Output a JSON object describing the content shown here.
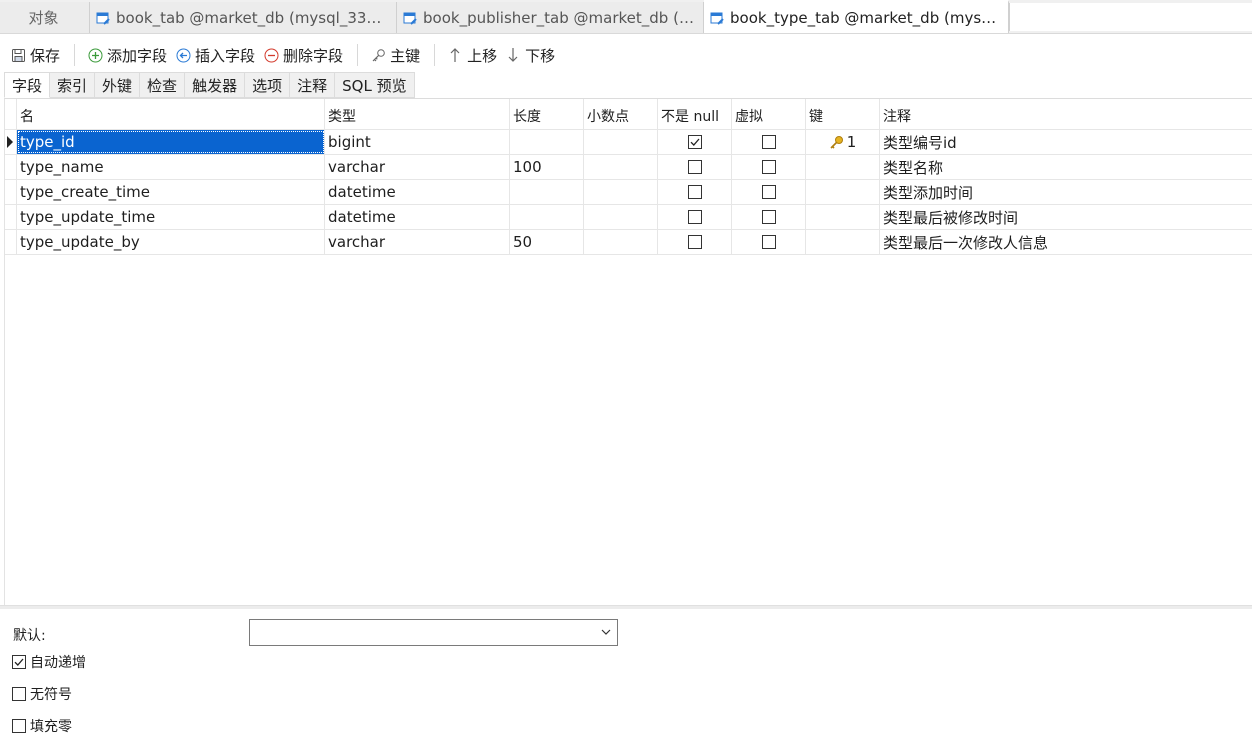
{
  "doc_tabs": {
    "objects": "对象",
    "tab1": "book_tab @market_db (mysql_3306)...",
    "tab2": "book_publisher_tab @market_db (m...",
    "tab3": "book_type_tab @market_db (mysql_..."
  },
  "toolbar": {
    "save": "保存",
    "add_field": "添加字段",
    "insert_field": "插入字段",
    "delete_field": "删除字段",
    "primary_key": "主键",
    "move_up": "上移",
    "move_down": "下移"
  },
  "sub_tabs": [
    "字段",
    "索引",
    "外键",
    "检查",
    "触发器",
    "选项",
    "注释",
    "SQL 预览"
  ],
  "grid": {
    "headers": {
      "name": "名",
      "type": "类型",
      "length": "长度",
      "decimal": "小数点",
      "not_null": "不是 null",
      "virtual": "虚拟",
      "key": "键",
      "comment": "注释"
    },
    "rows": [
      {
        "name": "type_id",
        "type": "bigint",
        "length": "",
        "decimal": "",
        "not_null": true,
        "virtual": false,
        "key": "1",
        "comment": "类型编号id"
      },
      {
        "name": "type_name",
        "type": "varchar",
        "length": "100",
        "decimal": "",
        "not_null": false,
        "virtual": false,
        "key": "",
        "comment": "类型名称"
      },
      {
        "name": "type_create_time",
        "type": "datetime",
        "length": "",
        "decimal": "",
        "not_null": false,
        "virtual": false,
        "key": "",
        "comment": "类型添加时间"
      },
      {
        "name": "type_update_time",
        "type": "datetime",
        "length": "",
        "decimal": "",
        "not_null": false,
        "virtual": false,
        "key": "",
        "comment": "类型最后被修改时间"
      },
      {
        "name": "type_update_by",
        "type": "varchar",
        "length": "50",
        "decimal": "",
        "not_null": false,
        "virtual": false,
        "key": "",
        "comment": "类型最后一次修改人信息"
      }
    ]
  },
  "bottom": {
    "default_label": "默认:",
    "default_value": "",
    "auto_increment": {
      "label": "自动递增",
      "checked": true
    },
    "unsigned": {
      "label": "无符号",
      "checked": false
    },
    "zerofill": {
      "label": "填充零",
      "checked": false
    }
  },
  "colors": {
    "selection": "#0a64d0",
    "key_icon": "#d9a21b",
    "add_green": "#3a9a3a",
    "delete_red": "#d33a2c",
    "tab_icon_blue": "#2a7ad5"
  }
}
